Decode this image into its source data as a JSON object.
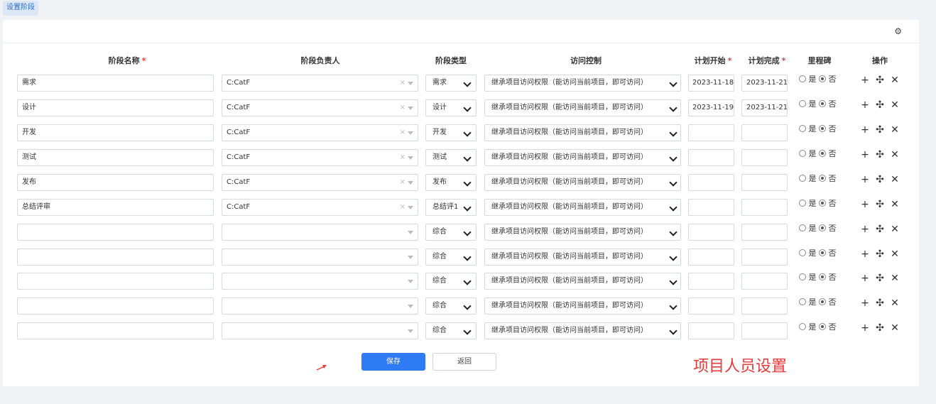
{
  "tab_label": "设置阶段",
  "headers": {
    "name": "阶段名称",
    "owner": "阶段负责人",
    "type": "阶段类型",
    "access": "访问控制",
    "plan_start": "计划开始",
    "plan_end": "计划完成",
    "milestone": "里程碑",
    "ops": "操作"
  },
  "required_mark": "*",
  "rows": [
    {
      "name": "需求",
      "owner": "C:CatF",
      "type": "需求",
      "access": "继承项目访问权限（能访问当前项目，即可访问）",
      "start": "2023-11-18",
      "end": "2023-11-21",
      "yes": "是",
      "no": "否"
    },
    {
      "name": "设计",
      "owner": "C:CatF",
      "type": "设计",
      "access": "继承项目访问权限（能访问当前项目，即可访问）",
      "start": "2023-11-19",
      "end": "2023-11-21",
      "yes": "是",
      "no": "否"
    },
    {
      "name": "开发",
      "owner": "C:CatF",
      "type": "开发",
      "access": "继承项目访问权限（能访问当前项目，即可访问）",
      "start": "",
      "end": "",
      "yes": "是",
      "no": "否"
    },
    {
      "name": "测试",
      "owner": "C:CatF",
      "type": "测试",
      "access": "继承项目访问权限（能访问当前项目，即可访问）",
      "start": "",
      "end": "",
      "yes": "是",
      "no": "否"
    },
    {
      "name": "发布",
      "owner": "C:CatF",
      "type": "发布",
      "access": "继承项目访问权限（能访问当前项目，即可访问）",
      "start": "",
      "end": "",
      "yes": "是",
      "no": "否"
    },
    {
      "name": "总结评审",
      "owner": "C:CatF",
      "type": "总结评1",
      "access": "继承项目访问权限（能访问当前项目，即可访问）",
      "start": "",
      "end": "",
      "yes": "是",
      "no": "否"
    },
    {
      "name": "",
      "owner": "",
      "type": "综合",
      "access": "继承项目访问权限（能访问当前项目，即可访问）",
      "start": "",
      "end": "",
      "yes": "是",
      "no": "否"
    },
    {
      "name": "",
      "owner": "",
      "type": "综合",
      "access": "继承项目访问权限（能访问当前项目，即可访问）",
      "start": "",
      "end": "",
      "yes": "是",
      "no": "否"
    },
    {
      "name": "",
      "owner": "",
      "type": "综合",
      "access": "继承项目访问权限（能访问当前项目，即可访问）",
      "start": "",
      "end": "",
      "yes": "是",
      "no": "否"
    },
    {
      "name": "",
      "owner": "",
      "type": "综合",
      "access": "继承项目访问权限（能访问当前项目，即可访问）",
      "start": "",
      "end": "",
      "yes": "是",
      "no": "否"
    },
    {
      "name": "",
      "owner": "",
      "type": "综合",
      "access": "继承项目访问权限（能访问当前项目，即可访问）",
      "start": "",
      "end": "",
      "yes": "是",
      "no": "否"
    }
  ],
  "buttons": {
    "save": "保存",
    "back": "返回"
  },
  "annotation": "项目人员设置",
  "icons": {
    "settings": "gear-icon",
    "add": "plus-icon",
    "move": "move-icon",
    "delete": "close-icon"
  },
  "colors": {
    "primary": "#2f7bf6",
    "required": "#e04040",
    "annotation": "#e83a3a"
  }
}
